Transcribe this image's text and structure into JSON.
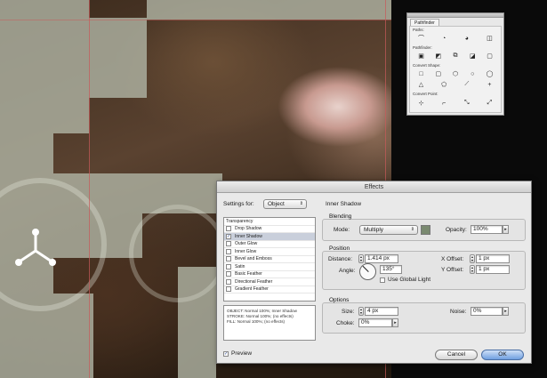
{
  "pathfinder": {
    "tab": "Pathfinder",
    "sections": [
      {
        "label": "Paths:",
        "icons": [
          "join-path-icon",
          "smooth-path-icon",
          "reverse-path-icon",
          "split-path-icon"
        ]
      },
      {
        "label": "Pathfinder:",
        "icons": [
          "unite-icon",
          "minus-front-icon",
          "intersect-icon",
          "exclude-icon",
          "divide-icon"
        ]
      },
      {
        "label": "Convert Shape:",
        "icons": [
          "rectangle-shape-icon",
          "rounded-rectangle-shape-icon",
          "beveled-rectangle-shape-icon",
          "inverse-rounded-shape-icon",
          "ellipse-shape-icon"
        ]
      },
      {
        "label": "",
        "icons": [
          "triangle-shape-icon",
          "polygon-shape-icon",
          "line-shape-icon",
          "orthogonal-line-shape-icon"
        ]
      },
      {
        "label": "Convert Point:",
        "icons": [
          "plain-point-icon",
          "corner-point-icon",
          "smooth-point-icon",
          "symmetrical-point-icon"
        ]
      }
    ]
  },
  "effects": {
    "title": "Effects",
    "settings_for_label": "Settings for:",
    "settings_for_value": "Object",
    "panel_title": "Inner Shadow",
    "effect_list": [
      {
        "label": "Transparency",
        "checkbox": false,
        "checked": false,
        "selected": false
      },
      {
        "label": "Drop Shadow",
        "checkbox": true,
        "checked": false,
        "selected": false
      },
      {
        "label": "Inner Shadow",
        "checkbox": true,
        "checked": true,
        "selected": true
      },
      {
        "label": "Outer Glow",
        "checkbox": true,
        "checked": false,
        "selected": false
      },
      {
        "label": "Inner Glow",
        "checkbox": true,
        "checked": false,
        "selected": false
      },
      {
        "label": "Bevel and Emboss",
        "checkbox": true,
        "checked": false,
        "selected": false
      },
      {
        "label": "Satin",
        "checkbox": true,
        "checked": false,
        "selected": false
      },
      {
        "label": "Basic Feather",
        "checkbox": true,
        "checked": false,
        "selected": false
      },
      {
        "label": "Directional Feather",
        "checkbox": true,
        "checked": false,
        "selected": false
      },
      {
        "label": "Gradient Feather",
        "checkbox": true,
        "checked": false,
        "selected": false
      }
    ],
    "summary": [
      "OBJECT: Normal 100%; Inner Shadow",
      "STROKE: Normal 100%; (no effects)",
      "FILL: Normal 100%; (no effects)"
    ],
    "blending": {
      "group_label": "Blending",
      "mode_label": "Mode:",
      "mode_value": "Multiply",
      "opacity_label": "Opacity:",
      "opacity_value": "100%"
    },
    "position": {
      "group_label": "Position",
      "distance_label": "Distance:",
      "distance_value": "1.414 px",
      "angle_label": "Angle:",
      "angle_value": "135°",
      "use_global_light_label": "Use Global Light",
      "x_offset_label": "X Offset:",
      "x_offset_value": "1 px",
      "y_offset_label": "Y Offset:",
      "y_offset_value": "1 px"
    },
    "options": {
      "group_label": "Options",
      "size_label": "Size:",
      "size_value": "4 px",
      "choke_label": "Choke:",
      "choke_value": "0%",
      "noise_label": "Noise:",
      "noise_value": "0%"
    },
    "preview_label": "Preview",
    "preview_checked": true,
    "cancel_label": "Cancel",
    "ok_label": "OK",
    "colors": {
      "shadow_swatch": "#7a8a70",
      "selection": "#c9cfdb",
      "default_button": "#6f9fe0"
    }
  }
}
